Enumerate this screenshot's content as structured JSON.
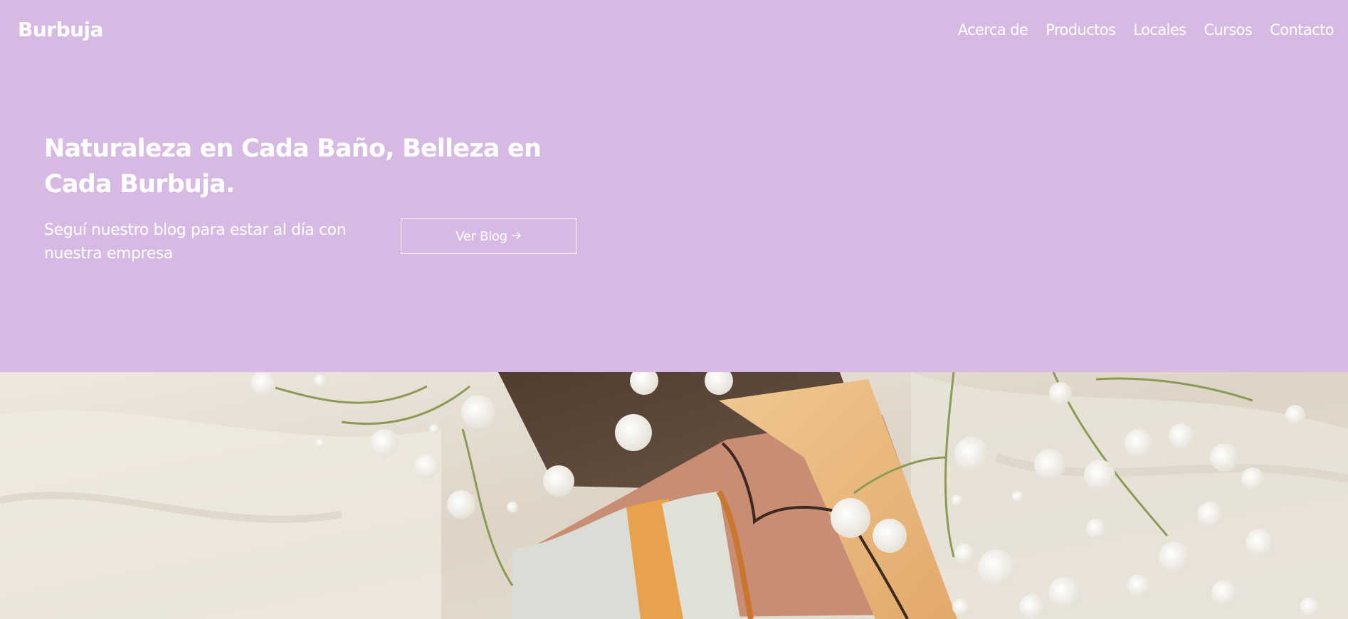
{
  "brand": {
    "name": "Burbuja"
  },
  "nav": {
    "items": [
      {
        "label": "Acerca de"
      },
      {
        "label": "Productos"
      },
      {
        "label": "Locales"
      },
      {
        "label": "Cursos"
      },
      {
        "label": "Contacto"
      }
    ]
  },
  "hero": {
    "headline_line1": "Naturaleza en Cada Baño, Belleza en",
    "headline_line2": "Cada Burbuja.",
    "subtitle_line1": "Seguí nuestro blog para estar al día con",
    "subtitle_line2": "nuestra empresa",
    "button_label": "Ver Blog",
    "button_icon": "arrow-right-icon"
  },
  "colors": {
    "hero_background": "#d6bae4",
    "text": "#ffffff"
  },
  "photo": {
    "description_icon": "soap-bar-with-flowers-photo"
  }
}
